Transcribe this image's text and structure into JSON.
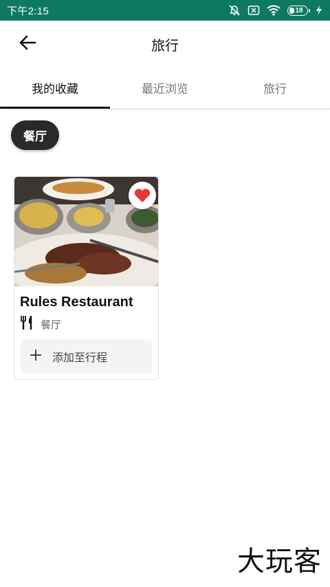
{
  "status_bar": {
    "time": "下午2:15",
    "battery_level": "18",
    "bg_color": "#0d7a5f"
  },
  "header": {
    "back_icon": "arrow-left-icon",
    "title": "旅行"
  },
  "tabs": [
    {
      "label": "我的收藏",
      "active": true
    },
    {
      "label": "最近浏览",
      "active": false
    },
    {
      "label": "旅行",
      "active": false
    }
  ],
  "filter_chip": {
    "label": "餐厅"
  },
  "cards": [
    {
      "title": "Rules Restaurant",
      "category_icon": "fork-knife-icon",
      "category": "餐厅",
      "favorite": true,
      "favorite_color": "#e53935",
      "add_label": "添加至行程"
    }
  ],
  "watermark": "大玩客"
}
